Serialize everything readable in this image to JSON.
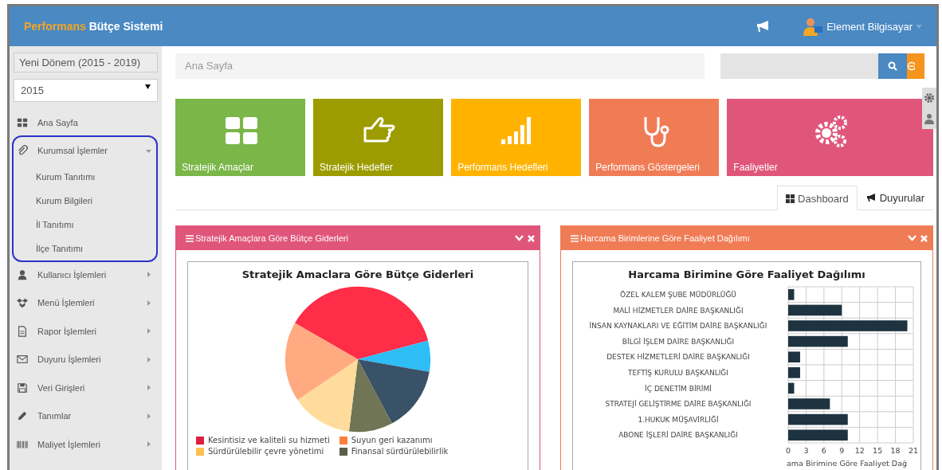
{
  "header": {
    "brand_accent": "Performans",
    "brand_rest": "Bütçe Sistemi",
    "user": "Element Bilgisayar"
  },
  "sidebar": {
    "period": "Yeni Dönem (2015 - 2019)",
    "year": "2015",
    "items": [
      {
        "label": "Ana Sayfa",
        "highlighted": false
      },
      {
        "label": "Kurumsal İşlemler",
        "highlighted": true,
        "expanded": true,
        "children": [
          {
            "label": "Kurum Tanıtımı"
          },
          {
            "label": "Kurum Bilgileri"
          },
          {
            "label": "İl Tanıtımı"
          },
          {
            "label": "İlçe Tanıtımı"
          }
        ]
      },
      {
        "label": "Kullanıcı İşlemleri",
        "highlighted": false,
        "expanded": false
      },
      {
        "label": "Menü İşlemleri",
        "highlighted": false,
        "expanded": false
      },
      {
        "label": "Rapor İşlemleri",
        "highlighted": false,
        "expanded": false
      },
      {
        "label": "Duyuru İşlemleri",
        "highlighted": false,
        "expanded": false
      },
      {
        "label": "Veri Girişleri",
        "highlighted": false,
        "expanded": false
      },
      {
        "label": "Tanımlar",
        "highlighted": false,
        "expanded": false
      },
      {
        "label": "Maliyet İşlemleri",
        "highlighted": false,
        "expanded": false
      }
    ]
  },
  "breadcrumb": "Ana Sayfa",
  "tiles": [
    {
      "label": "Stratejik Amaçlar",
      "color": "#7ab648"
    },
    {
      "label": "Stratejik Hedefler",
      "color": "#9c9c00"
    },
    {
      "label": "Performans Hedefleri",
      "color": "#ffb300"
    },
    {
      "label": "Performans Göstergeleri",
      "color": "#f07c56"
    },
    {
      "label": "Faaliyetler",
      "color": "#e0567b"
    }
  ],
  "tabs": [
    {
      "label": "Dashboard",
      "selected": true
    },
    {
      "label": "Duyurular",
      "selected": false
    }
  ],
  "panels": [
    {
      "title": "Stratejik Amaçlara Göre Bütçe Giderleri",
      "color": "#e0567b",
      "chart_title": "Stratejik Amaclara Göre Bütçe Giderleri",
      "legend": [
        {
          "label": "Kesintisiz ve kaliteli su hizmeti",
          "color": "#dc1f3f"
        },
        {
          "label": "Suyun geri kazanımı",
          "color": "#ff7f3f"
        },
        {
          "label": "Sürdürülebilir çevre yönetimi",
          "color": "#ffc04d"
        },
        {
          "label": "Finansal sürdürülebilirlik",
          "color": "#5a5f48"
        }
      ]
    },
    {
      "title": "Harcama Birimlerine Göre Faaliyet Dağılımı",
      "color": "#f07c56",
      "chart_data": {
        "type": "bar",
        "orientation": "horizontal",
        "title": "Harcama Birimine Göre Faaliyet Dağılımı",
        "xlabel": "ama Birimine Göre Faaliyet Dağ",
        "categories": [
          "ÖZEL KALEM ŞUBE MÜDÜRLÜĞÜ",
          "MALİ HİZMETLER DAİRE BAŞKANLIĞI",
          "İNSAN KAYNAKLARI VE EĞİTİM DAİRE BAŞKANLIĞI",
          "BİLGİ İŞLEM DAİRE BAŞKANLIĞI",
          "DESTEK HİZMETLERİ DAİRE BAŞKANLIĞI",
          "TEFTİŞ KURULU BAŞKANLIĞI",
          "İÇ DENETİM BİRİMİ",
          "STRATEJİ GELİŞTİRME DAİRE BAŞKANLIĞI",
          "1.HUKUK MÜŞAVİRLİĞİ",
          "ABONE İŞLERİ DAİRE BAŞKANLIĞI"
        ],
        "series": [
          {
            "color": "#1e3340",
            "values": [
              1,
              9,
              20,
              10,
              2,
              2,
              1,
              7,
              10,
              10
            ]
          }
        ],
        "grid": true,
        "xlim": [
          0,
          21
        ],
        "xticks": [
          0,
          3,
          6,
          9,
          12,
          15,
          18,
          21
        ]
      }
    }
  ]
}
